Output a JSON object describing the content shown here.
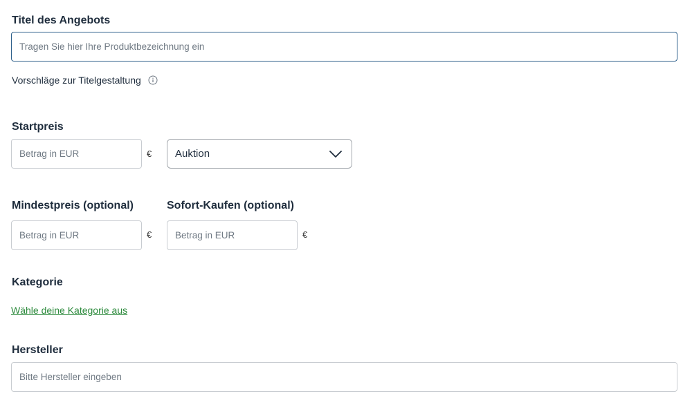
{
  "title_section": {
    "label": "Titel des Angebots",
    "placeholder": "Tragen Sie hier Ihre Produktbezeichnung ein",
    "suggestions_text": "Vorschläge zur Titelgestaltung"
  },
  "startpreis": {
    "label": "Startpreis",
    "placeholder": "Betrag in EUR",
    "currency": "€",
    "format_select": {
      "selected": "Auktion"
    }
  },
  "mindestpreis": {
    "label": "Mindestpreis (optional)",
    "placeholder": "Betrag in EUR",
    "currency": "€"
  },
  "sofort_kaufen": {
    "label": "Sofort-Kaufen (optional)",
    "placeholder": "Betrag in EUR",
    "currency": "€"
  },
  "kategorie": {
    "label": "Kategorie",
    "link": "Wähle deine Kategorie aus"
  },
  "hersteller": {
    "label": "Hersteller",
    "placeholder": "Bitte Hersteller eingeben"
  },
  "colors": {
    "text": "#1f2d3d",
    "link": "#2c8a3c",
    "focus_border": "#2c5f8a",
    "border": "#c8ccd1"
  },
  "icons": {
    "info": "info-circle-icon",
    "chevron": "chevron-down-icon"
  }
}
